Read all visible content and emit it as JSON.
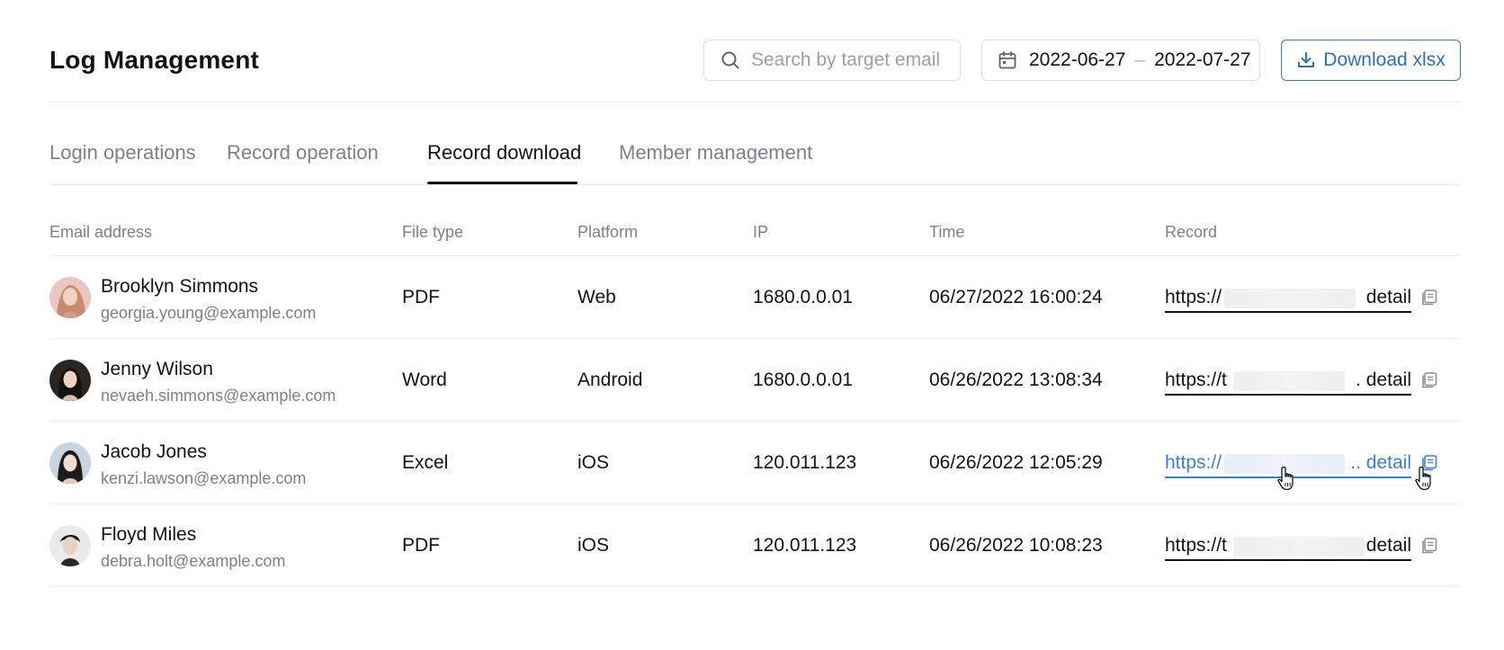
{
  "header": {
    "title": "Log Management",
    "search": {
      "placeholder": "Search by target email",
      "value": ""
    },
    "date_range": {
      "start": "2022-06-27",
      "separator": "–",
      "end": "2022-07-27"
    },
    "download_label": "Download xlsx",
    "accent_color": "#2d6fc3"
  },
  "tabs": [
    {
      "label": "Login operations",
      "active": false
    },
    {
      "label": "Record operation",
      "active": false
    },
    {
      "label": "Record download",
      "active": true
    },
    {
      "label": "Member management",
      "active": false
    }
  ],
  "table": {
    "columns": [
      "Email address",
      "File type",
      "Platform",
      "IP",
      "Time",
      "Record"
    ],
    "rows": [
      {
        "name": "Brooklyn Simmons",
        "email": "georgia.young@example.com",
        "file_type": "PDF",
        "platform": "Web",
        "ip": "1680.0.0.01",
        "time": "06/27/2022 16:00:24",
        "record_prefix": "https://",
        "record_suffix": "detail"
      },
      {
        "name": "Jenny Wilson",
        "email": "nevaeh.simmons@example.com",
        "file_type": "Word",
        "platform": "Android",
        "ip": "1680.0.0.01",
        "time": "06/26/2022 13:08:34",
        "record_prefix": "https://t",
        "record_suffix": ". detail"
      },
      {
        "name": "Jacob Jones",
        "email": "kenzi.lawson@example.com",
        "file_type": "Excel",
        "platform": "iOS",
        "ip": "120.011.123",
        "time": "06/26/2022 12:05:29",
        "record_prefix": "https://",
        "record_suffix": ".. detail"
      },
      {
        "name": "Floyd Miles",
        "email": "debra.holt@example.com",
        "file_type": "PDF",
        "platform": "iOS",
        "ip": "120.011.123",
        "time": "06/26/2022 10:08:23",
        "record_prefix": "https://t",
        "record_suffix": "detail"
      }
    ]
  },
  "icons": {
    "search": "search-icon",
    "calendar": "calendar-icon",
    "download": "download-icon",
    "copy": "copy-icon",
    "cursor": "hand-pointer-icon"
  }
}
